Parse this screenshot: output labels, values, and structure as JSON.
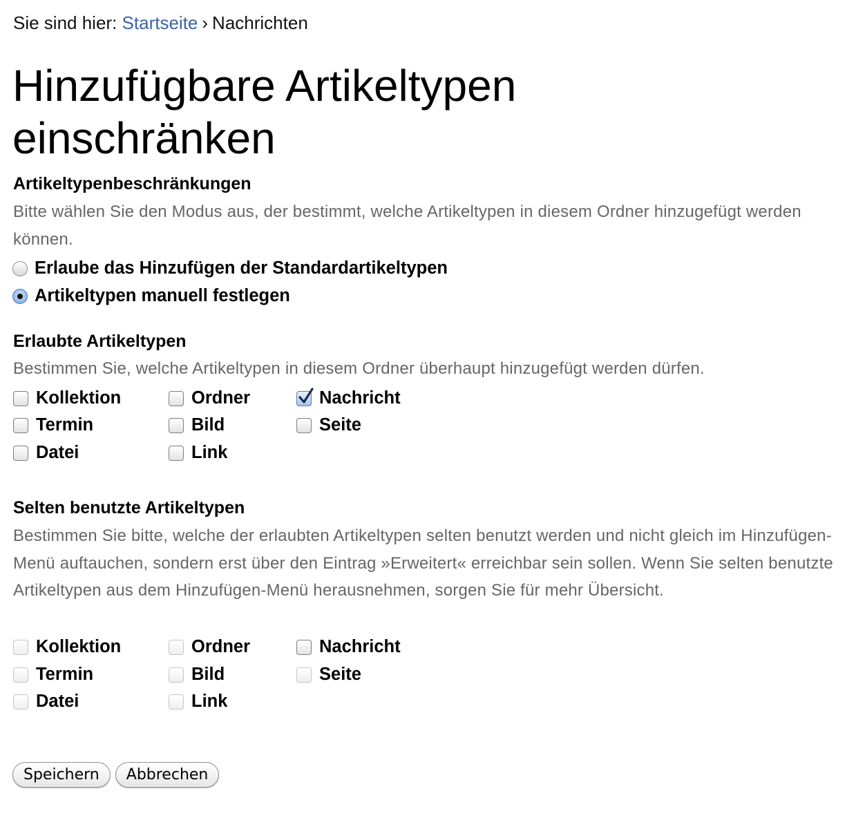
{
  "breadcrumb": {
    "prefix": "Sie sind hier:",
    "home": "Startseite",
    "separator": "›",
    "current": "Nachrichten"
  },
  "title": "Hinzufügbare Artikeltypen einschränken",
  "restrictions": {
    "heading": "Artikeltypenbeschränkungen",
    "help": "Bitte wählen Sie den Modus aus, der bestimmt, welche Artikeltypen in diesem Ordner hinzugefügt werden können.",
    "options": [
      {
        "label": "Erlaube das Hinzufügen der Standardartikeltypen",
        "selected": false
      },
      {
        "label": "Artikeltypen manuell festlegen",
        "selected": true
      }
    ]
  },
  "allowed": {
    "heading": "Erlaubte Artikeltypen",
    "help": "Bestimmen Sie, welche Artikeltypen in diesem Ordner überhaupt hinzugefügt werden dürfen.",
    "items": [
      {
        "label": "Kollektion",
        "checked": false
      },
      {
        "label": "Ordner",
        "checked": false
      },
      {
        "label": "Nachricht",
        "checked": true
      },
      {
        "label": "Termin",
        "checked": false
      },
      {
        "label": "Bild",
        "checked": false
      },
      {
        "label": "Seite",
        "checked": false
      },
      {
        "label": "Datei",
        "checked": false
      },
      {
        "label": "Link",
        "checked": false
      }
    ]
  },
  "secondary": {
    "heading": "Selten benutzte Artikeltypen",
    "help": "Bestimmen Sie bitte, welche der erlaubten Artikeltypen selten benutzt werden und nicht gleich im Hinzufügen-Menü auftauchen, sondern erst über den Eintrag »Erweitert« erreichbar sein sollen. Wenn Sie selten benutzte Artikeltypen aus dem Hinzufügen-Menü herausnehmen, sorgen Sie für mehr Übersicht.",
    "items": [
      {
        "label": "Kollektion",
        "checked": false
      },
      {
        "label": "Ordner",
        "checked": false
      },
      {
        "label": "Nachricht",
        "checked": false
      },
      {
        "label": "Termin",
        "checked": false
      },
      {
        "label": "Bild",
        "checked": false
      },
      {
        "label": "Seite",
        "checked": false
      },
      {
        "label": "Datei",
        "checked": false
      },
      {
        "label": "Link",
        "checked": false
      }
    ]
  },
  "buttons": {
    "save": "Speichern",
    "cancel": "Abbrechen"
  },
  "colors": {
    "link": "#3a64a6",
    "help_text": "#666666"
  }
}
